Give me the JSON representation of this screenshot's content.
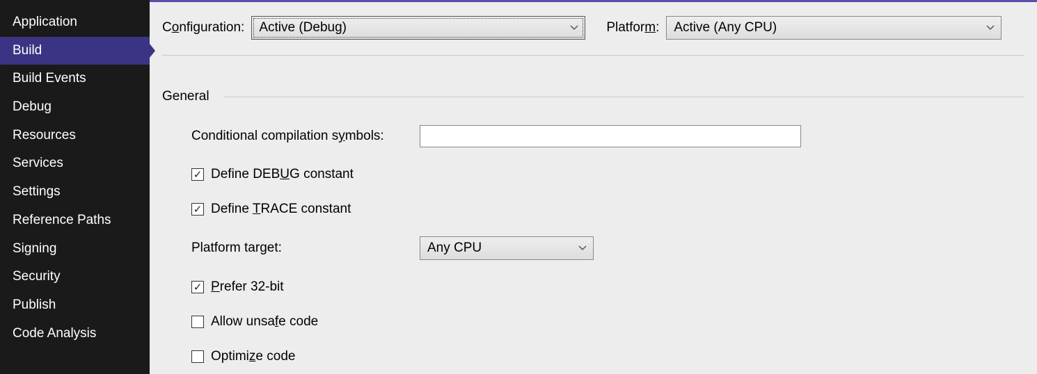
{
  "sidebar": {
    "items": [
      {
        "label": "Application",
        "active": false
      },
      {
        "label": "Build",
        "active": true
      },
      {
        "label": "Build Events",
        "active": false
      },
      {
        "label": "Debug",
        "active": false
      },
      {
        "label": "Resources",
        "active": false
      },
      {
        "label": "Services",
        "active": false
      },
      {
        "label": "Settings",
        "active": false
      },
      {
        "label": "Reference Paths",
        "active": false
      },
      {
        "label": "Signing",
        "active": false
      },
      {
        "label": "Security",
        "active": false
      },
      {
        "label": "Publish",
        "active": false
      },
      {
        "label": "Code Analysis",
        "active": false
      }
    ]
  },
  "top": {
    "configuration_label_pre": "C",
    "configuration_label_u": "o",
    "configuration_label_post": "nfiguration:",
    "configuration_value": "Active (Debug)",
    "platform_label_pre": "Platfor",
    "platform_label_u": "m",
    "platform_label_post": ":",
    "platform_value": "Active (Any CPU)"
  },
  "section": {
    "general": "General"
  },
  "general": {
    "cond_symbols_label_pre": "Conditional compilation s",
    "cond_symbols_label_u": "y",
    "cond_symbols_label_post": "mbols:",
    "cond_symbols_value": "",
    "define_debug_pre": "Define DEB",
    "define_debug_u": "U",
    "define_debug_post": "G constant",
    "define_debug_checked": true,
    "define_trace_pre": "Define ",
    "define_trace_u": "T",
    "define_trace_post": "RACE constant",
    "define_trace_checked": true,
    "platform_target_label_pre": "Platform tar",
    "platform_target_label_u": "g",
    "platform_target_label_post": "et:",
    "platform_target_value": "Any CPU",
    "prefer32_pre": "",
    "prefer32_u": "P",
    "prefer32_post": "refer 32-bit",
    "prefer32_checked": true,
    "unsafe_pre": "Allow unsa",
    "unsafe_u": "f",
    "unsafe_post": "e code",
    "unsafe_checked": false,
    "optimize_pre": "Optimi",
    "optimize_u": "z",
    "optimize_post": "e code",
    "optimize_checked": false
  }
}
